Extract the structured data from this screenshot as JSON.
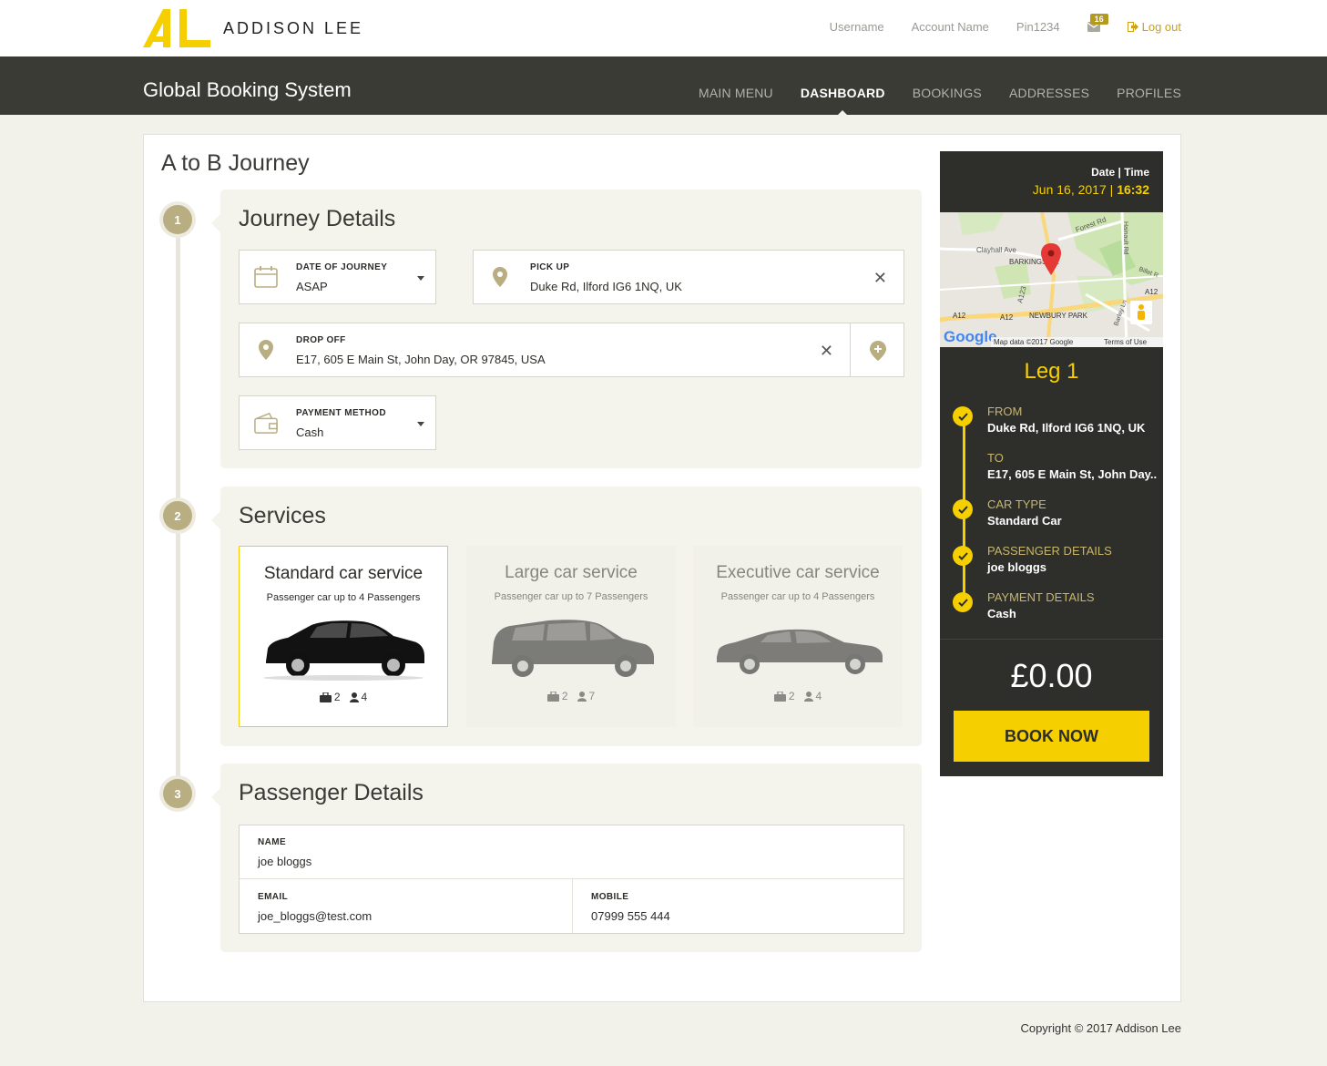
{
  "header": {
    "brand": "ADDISON LEE",
    "username": "Username",
    "account_name": "Account Name",
    "pin": "Pin1234",
    "mail_count": "16",
    "logout": "Log out"
  },
  "nav": {
    "title": "Global Booking System",
    "items": [
      {
        "label": "MAIN MENU"
      },
      {
        "label": "DASHBOARD"
      },
      {
        "label": "BOOKINGS"
      },
      {
        "label": "ADDRESSES"
      },
      {
        "label": "PROFILES"
      }
    ],
    "active": "DASHBOARD"
  },
  "page": {
    "title": "A to B Journey"
  },
  "steps": [
    "1",
    "2",
    "3"
  ],
  "journey": {
    "title": "Journey Details",
    "date": {
      "label": "DATE OF JOURNEY",
      "value": "ASAP"
    },
    "pickup": {
      "label": "PICK UP",
      "value": "Duke Rd, Ilford IG6 1NQ, UK"
    },
    "dropoff": {
      "label": "DROP OFF",
      "value": "E17, 605 E Main St, John Day, OR 97845, USA"
    },
    "payment": {
      "label": "PAYMENT METHOD",
      "value": "Cash"
    }
  },
  "services": {
    "title": "Services",
    "items": [
      {
        "title": "Standard car service",
        "sub": "Passenger car up to 4 Passengers",
        "luggage": "2",
        "passengers": "4"
      },
      {
        "title": "Large car service",
        "sub": "Passenger car up to 7 Passengers",
        "luggage": "2",
        "passengers": "7"
      },
      {
        "title": "Executive car service",
        "sub": "Passenger car up to 4 Passengers",
        "luggage": "2",
        "passengers": "4"
      }
    ]
  },
  "passenger": {
    "title": "Passenger Details",
    "name": {
      "label": "NAME",
      "value": "joe bloggs"
    },
    "email": {
      "label": "EMAIL",
      "value": "joe_bloggs@test.com"
    },
    "mobile": {
      "label": "MOBILE",
      "value": "07999 555 444"
    }
  },
  "summary": {
    "dt_label_date": "Date",
    "dt_label_sep": "|",
    "dt_label_time": "Time",
    "date": "Jun 16, 2017",
    "time": "16:32",
    "map_labels": {
      "clayhall": "Clayhall Ave",
      "barking": "BARKINGSIDE",
      "forest": "Forest Rd",
      "hainault": "Hainault Rd",
      "billet": "Billet R",
      "a12a": "A12",
      "a12b": "A12",
      "a12c": "A12",
      "a123": "A123",
      "newbury": "NEWBURY PARK",
      "barley": "Barley Ln",
      "google": "Google",
      "mapdata": "Map data ©2017 Google",
      "terms": "Terms of Use"
    },
    "leg_title": "Leg 1",
    "from_label": "FROM",
    "from_value": "Duke Rd, Ilford IG6 1NQ, UK",
    "to_label": "TO",
    "to_value": "E17, 605 E Main St, John Day..",
    "car_label": "CAR TYPE",
    "car_value": "Standard Car",
    "pass_label": "PASSENGER DETAILS",
    "pass_value": "joe bloggs",
    "pay_label": "PAYMENT DETAILS",
    "pay_value": "Cash",
    "price": "£0.00",
    "book_now": "BOOK NOW"
  },
  "footer": {
    "copyright": "Copyright © 2017 Addison Lee"
  },
  "colors": {
    "accent": "#f5cf00",
    "dark": "#2e2e2b",
    "step": "#b9ad82"
  }
}
